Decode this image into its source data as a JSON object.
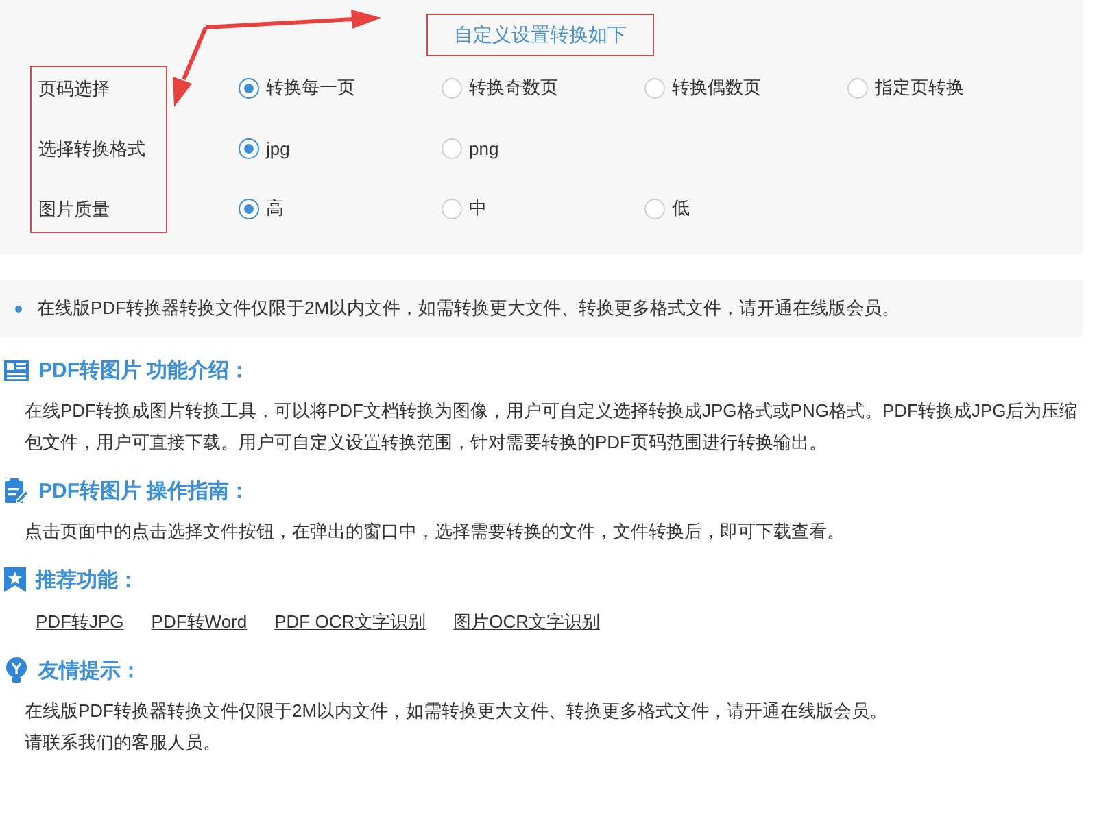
{
  "settings": {
    "title": "自定义设置转换如下",
    "rows": [
      {
        "label": "页码选择",
        "options": [
          {
            "label": "转换每一页",
            "selected": true
          },
          {
            "label": "转换奇数页",
            "selected": false
          },
          {
            "label": "转换偶数页",
            "selected": false
          },
          {
            "label": "指定页转换",
            "selected": false
          }
        ]
      },
      {
        "label": "选择转换格式",
        "options": [
          {
            "label": "jpg",
            "selected": true
          },
          {
            "label": "png",
            "selected": false
          }
        ]
      },
      {
        "label": "图片质量",
        "options": [
          {
            "label": "高",
            "selected": true
          },
          {
            "label": "中",
            "selected": false
          },
          {
            "label": "低",
            "selected": false
          }
        ]
      }
    ]
  },
  "notice": "在线版PDF转换器转换文件仅限于2M以内文件，如需转换更大文件、转换更多格式文件，请开通在线版会员。",
  "sections": [
    {
      "kind": "intro",
      "title": "PDF转图片 功能介绍：",
      "paragraphs": [
        "在线PDF转换成图片转换工具，可以将PDF文档转换为图像，用户可自定义选择转换成JPG格式或PNG格式。PDF转换成JPG后为压缩包文件，用户可直接下载。用户可自定义设置转换范围，针对需要转换的PDF页码范围进行转换输出。"
      ]
    },
    {
      "kind": "guide",
      "title": "PDF转图片 操作指南：",
      "paragraphs": [
        "点击页面中的点击选择文件按钮，在弹出的窗口中，选择需要转换的文件，文件转换后，即可下载查看。"
      ]
    },
    {
      "kind": "recommend",
      "title": "推荐功能：",
      "links": [
        "PDF转JPG",
        "PDF转Word",
        "PDF OCR文字识别",
        "图片OCR文字识别"
      ]
    },
    {
      "kind": "tip",
      "title": "友情提示：",
      "paragraphs": [
        "在线版PDF转换器转换文件仅限于2M以内文件，如需转换更大文件、转换更多格式文件，请开通在线版会员。",
        "请联系我们的客服人员。"
      ]
    }
  ]
}
